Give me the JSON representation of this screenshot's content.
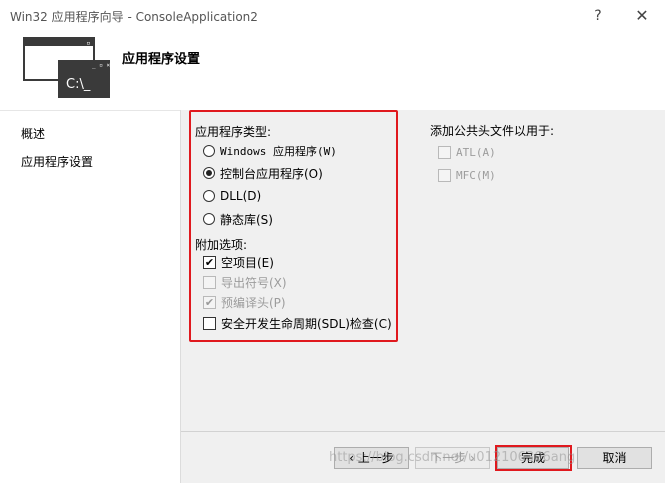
{
  "window": {
    "title": "Win32 应用程序向导 - ConsoleApplication2",
    "help_glyph": "?",
    "close_glyph": "✕"
  },
  "header": {
    "icon_text": "C:\\_",
    "title": "应用程序设置"
  },
  "sidebar": {
    "items": [
      {
        "label": "概述"
      },
      {
        "label": "应用程序设置"
      }
    ]
  },
  "app_type": {
    "label": "应用程序类型:",
    "options": [
      {
        "label": "Windows 应用程序(W)",
        "selected": false
      },
      {
        "label": "控制台应用程序(O)",
        "selected": true
      },
      {
        "label": "DLL(D)",
        "selected": false
      },
      {
        "label": "静态库(S)",
        "selected": false
      }
    ]
  },
  "extra_options": {
    "label": "附加选项:",
    "options": [
      {
        "label": "空项目(E)",
        "checked": true,
        "enabled": true
      },
      {
        "label": "导出符号(X)",
        "checked": false,
        "enabled": false
      },
      {
        "label": "预编译头(P)",
        "checked": true,
        "enabled": false
      },
      {
        "label": "安全开发生命周期(SDL)检查(C)",
        "checked": false,
        "enabled": true
      }
    ]
  },
  "common_headers": {
    "label": "添加公共头文件以用于:",
    "options": [
      {
        "label": "ATL(A)",
        "checked": false,
        "enabled": false
      },
      {
        "label": "MFC(M)",
        "checked": false,
        "enabled": false
      }
    ]
  },
  "buttons": {
    "prev": "‹ 上一步",
    "next": "下一步 ›",
    "finish": "完成",
    "cancel": "取消"
  },
  "watermark": "https://blog.csdn.net/u012106306ang",
  "colors": {
    "highlight": "#e0191e",
    "panel": "#f0f0f0"
  }
}
